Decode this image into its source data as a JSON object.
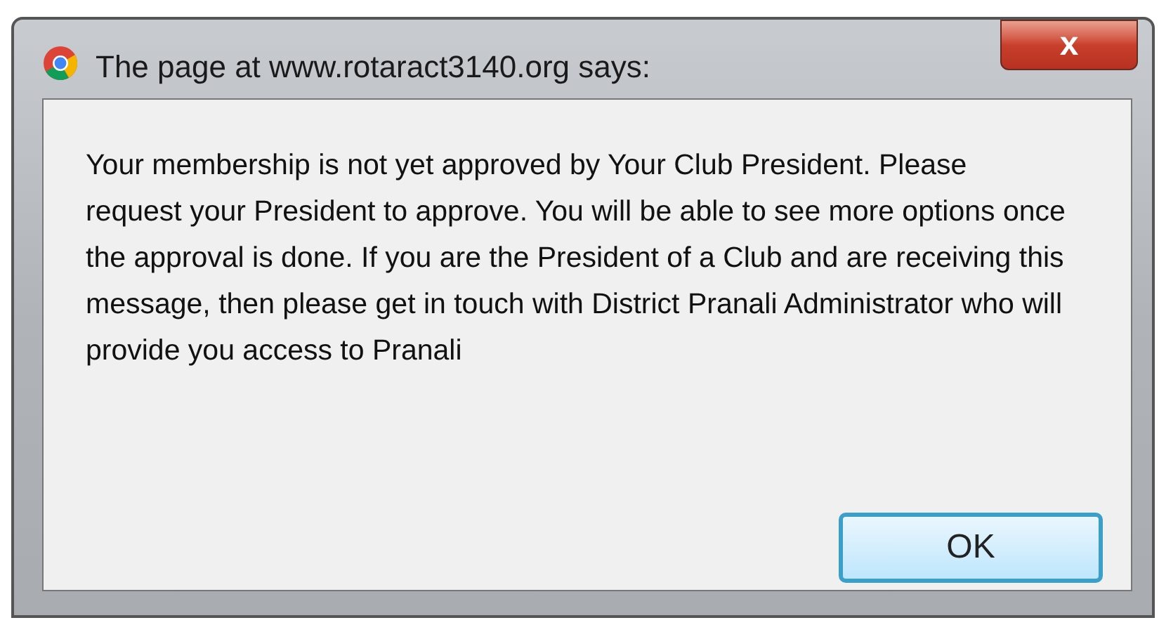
{
  "window": {
    "title": "The page at www.rotaract3140.org says:",
    "close": "x"
  },
  "message": "Your membership is not yet approved by Your Club President. Please request your President to approve. You will be able to see more options once the approval is done. If you are the President of a Club and are receiving this message, then please get in touch with District Pranali Administrator who will provide you access to Pranali",
  "buttons": [
    {
      "label": "OK",
      "focused": true
    }
  ]
}
